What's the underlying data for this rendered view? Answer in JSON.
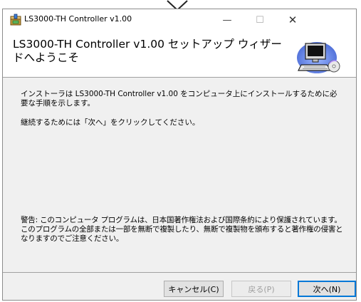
{
  "window": {
    "title": "LS3000-TH Controller v1.00",
    "minimize_glyph": "—",
    "maximize_glyph": "☐",
    "close_glyph": "✕"
  },
  "header": {
    "title": "LS3000-TH Controller v1.00 セットアップ ウィザードへようこそ"
  },
  "body": {
    "paragraph1": "インストーラは LS3000-TH Controller v1.00 をコンピュータ上にインストールするために必要な手順を示します。",
    "paragraph2": "継続するためには「次へ」をクリックしてください。",
    "warning": "警告: このコンピュータ プログラムは、日本国著作権法および国際条約により保護されています。このプログラムの全部または一部を無断で複製したり、無断で複製物を頒布すると著作権の侵害となりますのでご注意ください。"
  },
  "buttons": {
    "cancel": "キャンセル(C)",
    "back": "戻る(P)",
    "next": "次へ(N)"
  },
  "icons": {
    "title_icon": "installer-package-icon",
    "header_art": "computer-setup-icon"
  },
  "colors": {
    "accent": "#0078d7",
    "window_bg": "#f0f0f0"
  }
}
